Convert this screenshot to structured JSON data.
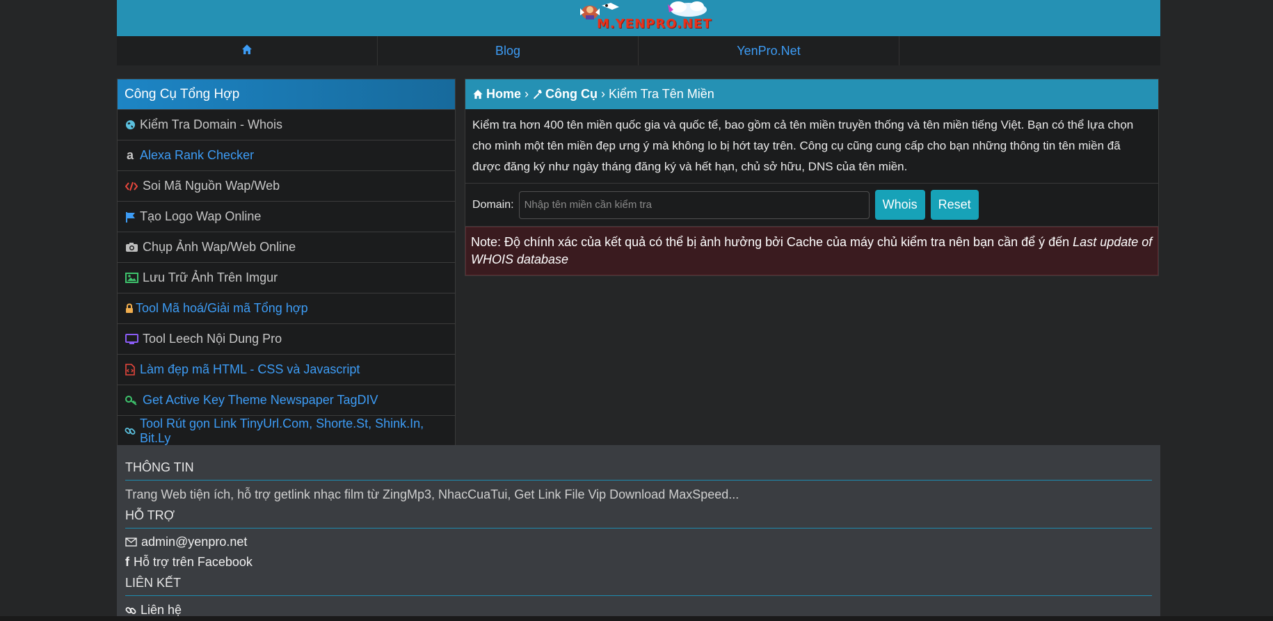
{
  "header": {
    "logo_text": "M.YENPRO.NET"
  },
  "nav": {
    "home_icon": "home-icon",
    "items": [
      {
        "label": "Blog"
      },
      {
        "label": "YenPro.Net"
      }
    ]
  },
  "sidebar": {
    "title": "Công Cụ Tổng Hợp",
    "items": [
      {
        "label": "Kiểm Tra Domain - Whois",
        "icon": "globe-icon",
        "color": "#c6c6c6"
      },
      {
        "label": "Alexa Rank Checker",
        "icon": "amazon-icon",
        "color": "#3d9cf5"
      },
      {
        "label": "Soi Mã Nguồn Wap/Web",
        "icon": "code-icon",
        "color": "#c6c6c6"
      },
      {
        "label": "Tạo Logo Wap Online",
        "icon": "flag-icon",
        "color": "#c6c6c6"
      },
      {
        "label": "Chụp Ảnh Wap/Web Online",
        "icon": "camera-icon",
        "color": "#c6c6c6"
      },
      {
        "label": "Lưu Trữ Ảnh Trên Imgur",
        "icon": "image-icon",
        "color": "#c6c6c6"
      },
      {
        "label": "Tool Mã hoá/Giải mã Tổng hợp",
        "icon": "lock-icon",
        "color": "#3d9cf5"
      },
      {
        "label": "Tool Leech Nội Dung Pro",
        "icon": "desktop-icon",
        "color": "#c6c6c6"
      },
      {
        "label": "Làm đẹp mã HTML - CSS và Javascript",
        "icon": "file-code-icon",
        "color": "#3d9cf5"
      },
      {
        "label": "Get Active Key Theme Newspaper TagDIV",
        "icon": "key-icon",
        "color": "#3d9cf5"
      },
      {
        "label": "Tool Rút gọn Link TinyUrl.Com, Shorte.St, Shink.In, Bit.Ly",
        "icon": "link-icon",
        "color": "#3d9cf5"
      }
    ]
  },
  "breadcrumb": {
    "home": "Home",
    "tools": "Công Cụ",
    "current": "Kiểm Tra Tên Miền"
  },
  "main": {
    "description": "Kiểm tra hơn 400 tên miền quốc gia và quốc tế, bao gồm cả tên miền truyền thống và tên miền tiếng Việt. Bạn có thể lựa chọn cho mình một tên miền đẹp ưng ý mà không lo bị hớt tay trên. Công cụ cũng cung cấp cho bạn những thông tin tên miền đã được đăng ký như ngày tháng đăng ký và hết hạn, chủ sở hữu, DNS của tên miền.",
    "domain_label": "Domain:",
    "domain_placeholder": "Nhập tên miền cần kiểm tra",
    "domain_value": "",
    "whois_button": "Whois",
    "reset_button": "Reset",
    "note_text": "Note: Độ chính xác của kết quả có thể bị ảnh hưởng bởi Cache của máy chủ kiểm tra nên bạn cần để ý đến ",
    "note_italic": "Last update of WHOIS database"
  },
  "footer": {
    "info_title": "THÔNG TIN",
    "info_text": "Trang Web tiện ích, hỗ trợ getlink nhạc film từ ZingMp3, NhacCuaTui, Get Link File Vip Download MaxSpeed...",
    "support_title": "HỖ TRỢ",
    "email": "admin@yenpro.net",
    "facebook": "Hỗ trợ trên Facebook",
    "links_title": "LIÊN KẾT",
    "contact": "Liên hệ"
  },
  "colors": {
    "accent": "#2591b4",
    "link": "#3d9cf5",
    "button": "#17a2b8",
    "note_bg": "#3a1b1f"
  }
}
